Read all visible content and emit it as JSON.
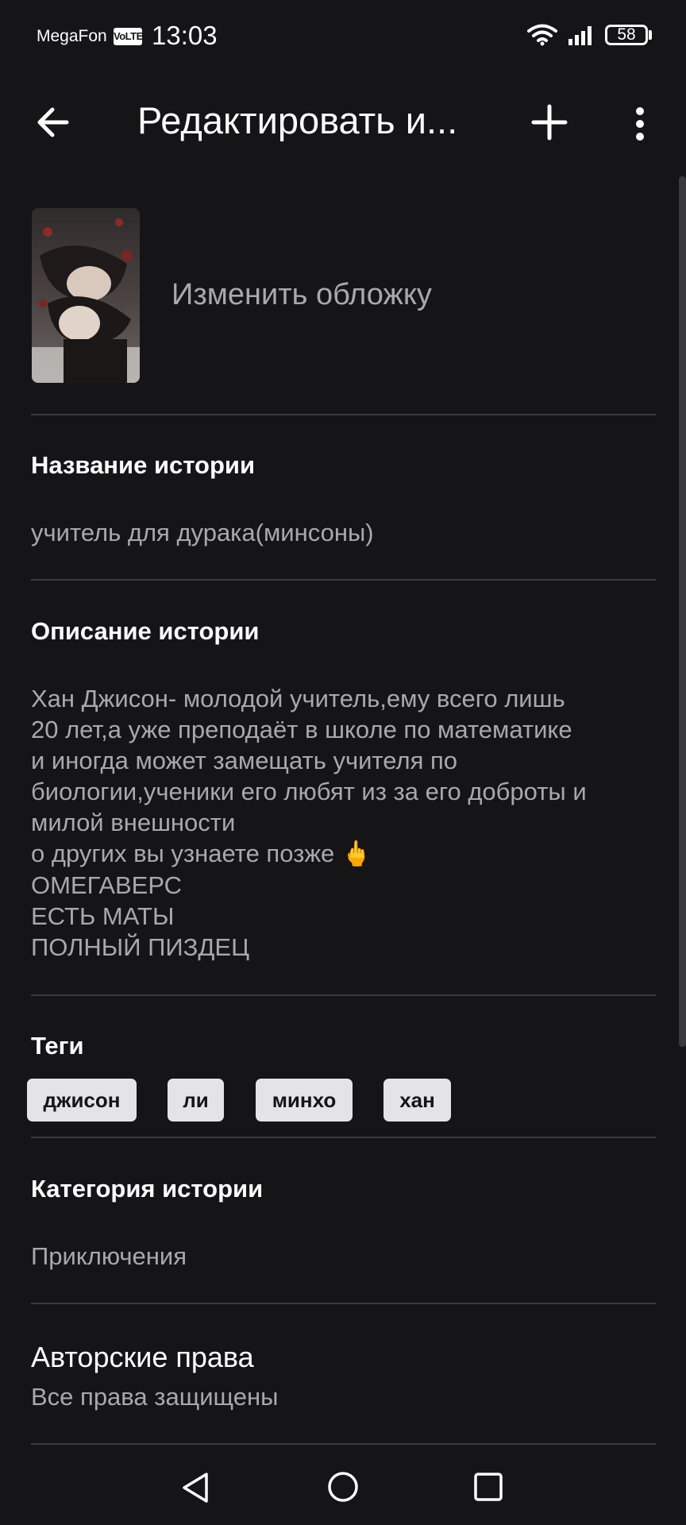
{
  "status_bar": {
    "carrier": "MegaFon",
    "volte": "VoLTE",
    "time": "13:03",
    "battery": "58"
  },
  "header": {
    "title": "Редактировать и..."
  },
  "cover": {
    "change_label": "Изменить обложку"
  },
  "fields": {
    "title_label": "Название истории",
    "title_value": "учитель для дурака(минсоны)",
    "description_label": "Описание истории",
    "description_lines": [
      "Хан Джисон- молодой учитель,ему всего лишь",
      "20 лет,а уже преподаёт в школе по математике",
      "и иногда может замещать учителя по",
      "биологии,ученики его любят из за его доброты и",
      "милой внешности",
      "о других вы узнаете позже",
      "ОМЕГАВЕРС",
      "ЕСТЬ МАТЫ",
      "ПОЛНЫЙ ПИЗДЕЦ"
    ],
    "description_emoji": "🖕",
    "tags_label": "Теги",
    "tags": [
      "джисон",
      "ли",
      "минхо",
      "хан"
    ],
    "category_label": "Категория истории",
    "category_value": "Приключения",
    "copyright_label": "Авторские права",
    "copyright_value": "Все права защищены"
  },
  "colors": {
    "background": "#151417",
    "text_primary": "#ffffff",
    "text_secondary": "#a9a8ac",
    "divider": "#3b3a3e",
    "tag_bg": "#e4e4e6"
  },
  "icons": {
    "back": "arrow-left-icon",
    "add": "plus-icon",
    "more": "more-vertical-icon",
    "nav_back": "triangle-back-icon",
    "nav_home": "circle-home-icon",
    "nav_recent": "square-recent-icon"
  }
}
